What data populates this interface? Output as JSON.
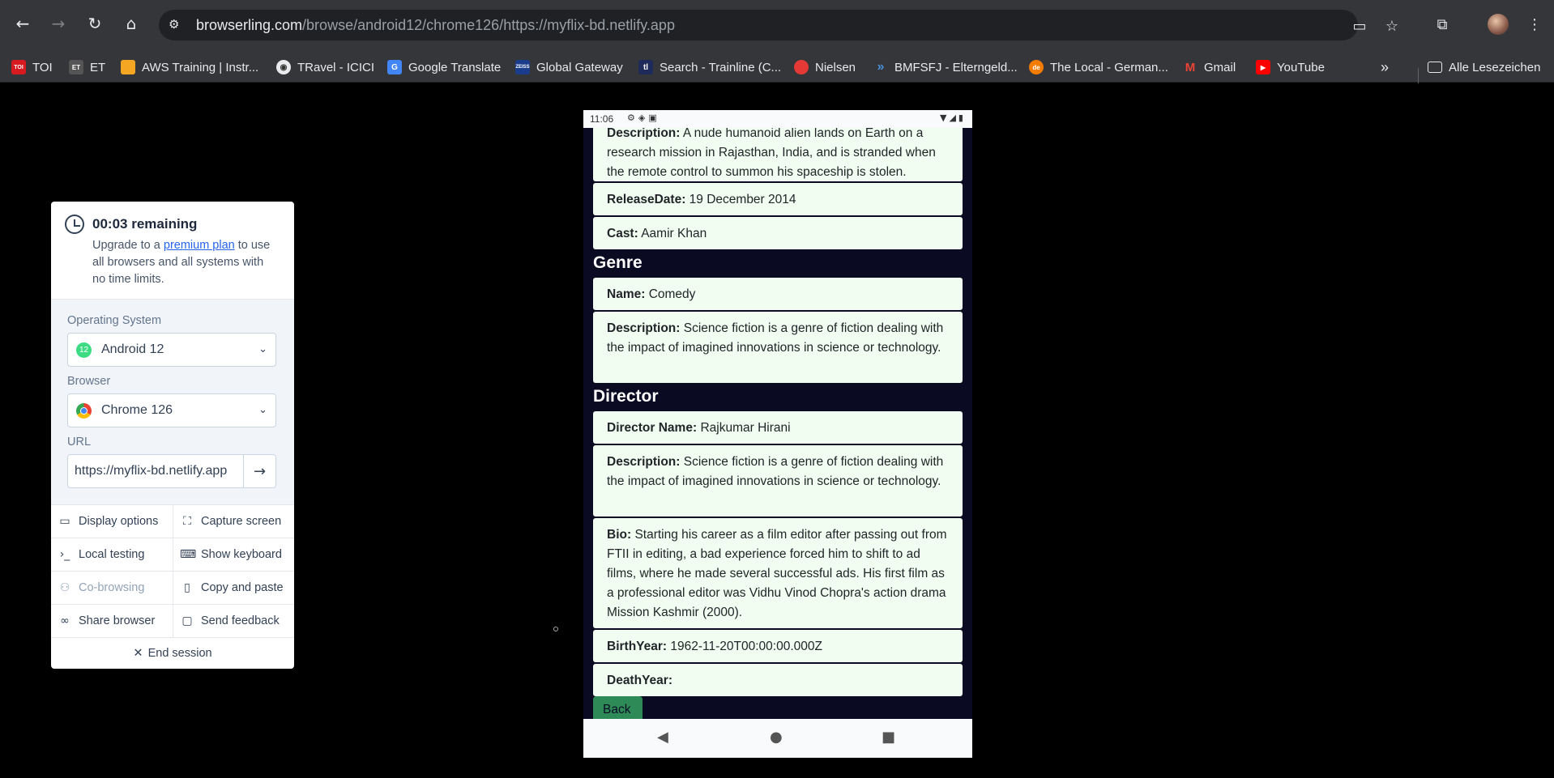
{
  "browser": {
    "url_domain": "browserling.com",
    "url_path": "/browse/android12/chrome126/https://myflix-bd.netlify.app",
    "bookmarks": [
      {
        "label": "TOI",
        "color": "#d71920",
        "icon": "TOI"
      },
      {
        "label": "ET",
        "color": "#555555",
        "icon": "ET"
      },
      {
        "label": "AWS Training | Instr...",
        "color": "#f5a623",
        "icon": "aws"
      },
      {
        "label": "TRavel - ICICI",
        "color": "#e8eaed",
        "icon": "globe"
      },
      {
        "label": "Google Translate",
        "color": "#4285f4",
        "icon": "G"
      },
      {
        "label": "Global Gateway",
        "color": "#1a3c8c",
        "icon": "ZEISS"
      },
      {
        "label": "Search - Trainline (C...",
        "color": "#1e2a5a",
        "icon": "tl"
      },
      {
        "label": "Nielsen",
        "color": "#e53935",
        "icon": "N"
      },
      {
        "label": "BMFSFJ - Elterngeld...",
        "color": "#4a90d9",
        "icon": "chev"
      },
      {
        "label": "The Local - German...",
        "color": "#f57c00",
        "icon": "de"
      },
      {
        "label": "Gmail",
        "color": "#ea4335",
        "icon": "M"
      },
      {
        "label": "YouTube",
        "color": "#ff0000",
        "icon": "play"
      }
    ],
    "all_bookmarks_label": "Alle Lesezeichen"
  },
  "panel": {
    "remaining": "00:03 remaining",
    "upgrade_prefix": "Upgrade to a ",
    "upgrade_link": "premium plan",
    "upgrade_suffix": " to use all browsers and all systems with no time limits.",
    "os_label": "Operating System",
    "os_value": "Android 12",
    "browser_label": "Browser",
    "browser_value": "Chrome 126",
    "url_label": "URL",
    "url_value": "https://myflix-bd.netlify.app",
    "buttons": {
      "display_options": "Display options",
      "capture_screen": "Capture screen",
      "local_testing": "Local testing",
      "show_keyboard": "Show keyboard",
      "co_browsing": "Co-browsing",
      "copy_paste": "Copy and paste",
      "share_browser": "Share browser",
      "send_feedback": "Send feedback",
      "end_session": "End session"
    }
  },
  "phone": {
    "time": "11:06",
    "movie": {
      "description_label": "Description:",
      "description": "A nude humanoid alien lands on Earth on a research mission in Rajasthan, India, and is stranded when the remote control to summon his spaceship is stolen.",
      "release_label": "ReleaseDate:",
      "release": "19 December 2014",
      "cast_label": "Cast:",
      "cast": "Aamir Khan"
    },
    "genre": {
      "heading": "Genre",
      "name_label": "Name:",
      "name": "Comedy",
      "description_label": "Description:",
      "description": "Science fiction is a genre of fiction dealing with the impact of imagined innovations in science or technology."
    },
    "director": {
      "heading": "Director",
      "name_label": "Director Name:",
      "name": "Rajkumar Hirani",
      "description_label": "Description:",
      "description": "Science fiction is a genre of fiction dealing with the impact of imagined innovations in science or technology.",
      "bio_label": "Bio:",
      "bio": "Starting his career as a film editor after passing out from FTII in editing, a bad experience forced him to shift to ad films, where he made several successful ads. His first film as a professional editor was Vidhu Vinod Chopra's action drama Mission Kashmir (2000).",
      "birth_label": "BirthYear:",
      "birth": "1962-11-20T00:00:00.000Z",
      "death_label": "DeathYear:",
      "death": ""
    },
    "back_label": "Back"
  }
}
